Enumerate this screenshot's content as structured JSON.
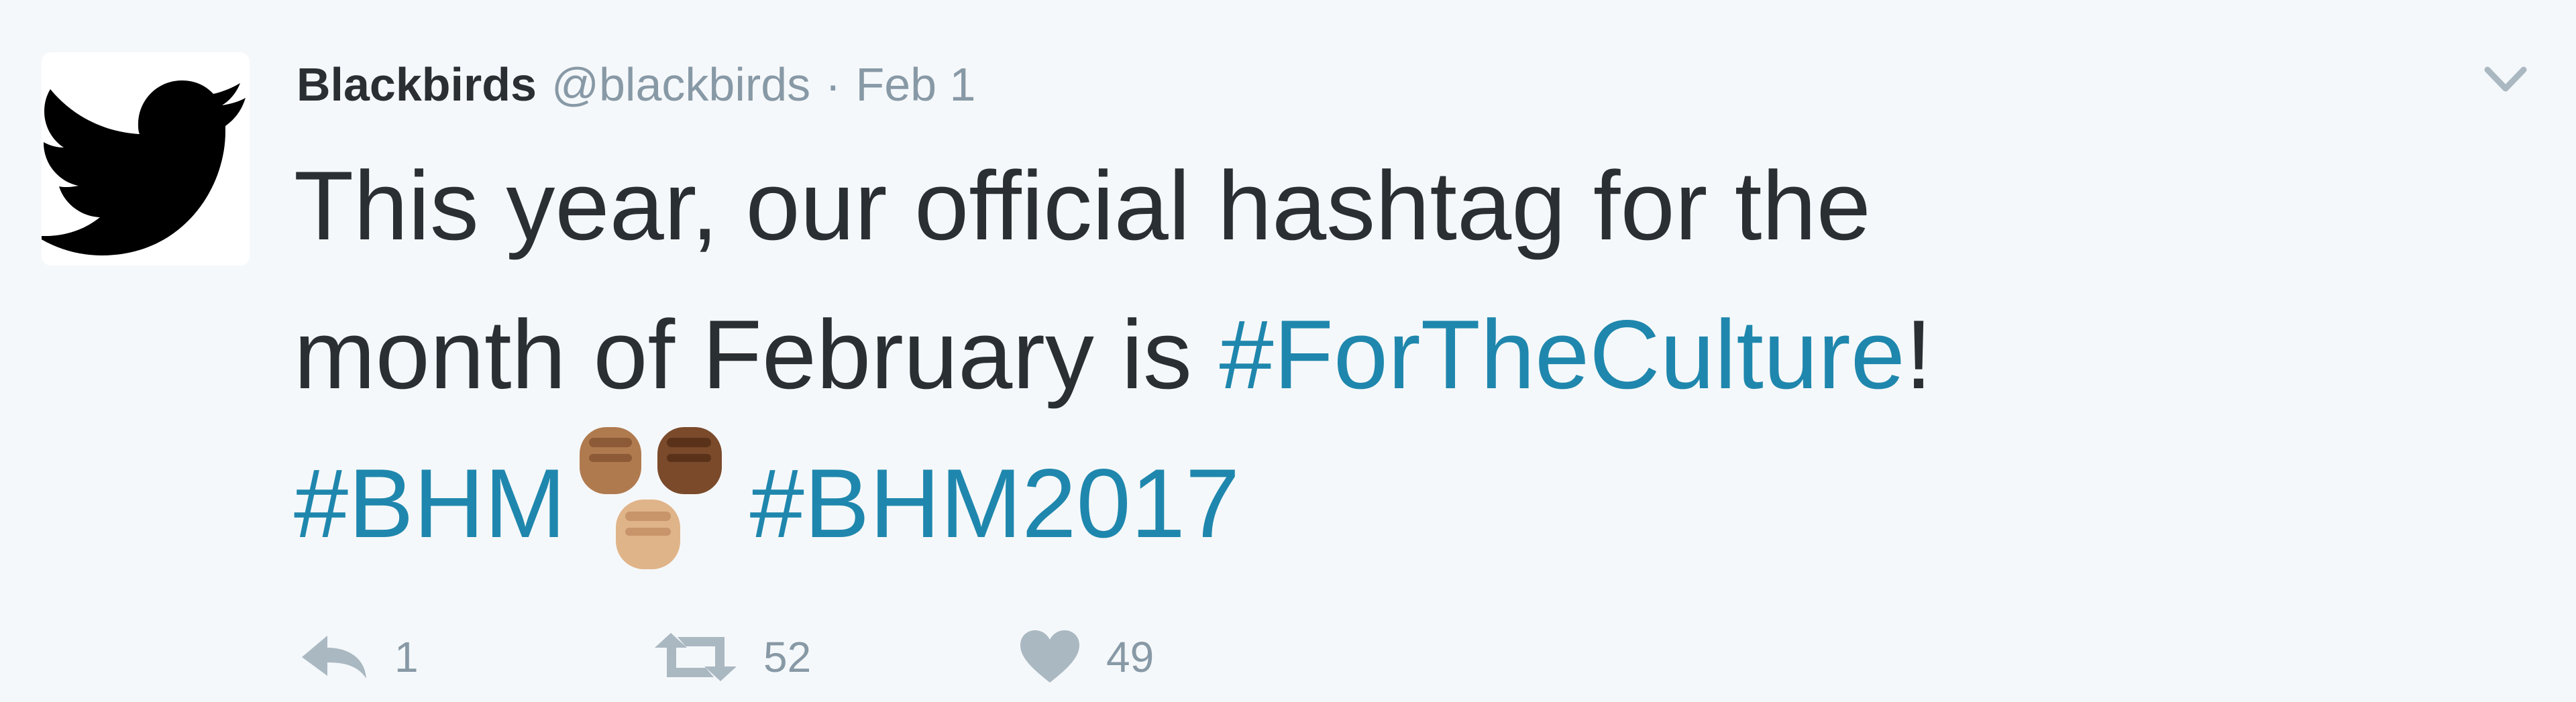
{
  "tweet": {
    "author_name": "Blackbirds",
    "author_handle": "@blackbirds",
    "separator": "·",
    "timestamp": "Feb 1",
    "text_line1": "This year, our official hashtag for the",
    "text_line2_prefix": "month of February is ",
    "hashtag_culture": "#ForTheCulture",
    "text_line2_suffix": "!",
    "hashtag_bhm": "#BHM",
    "hashtag_bhm2017": "#BHM2017"
  },
  "actions": {
    "reply_count": "1",
    "retweet_count": "52",
    "like_count": "49"
  },
  "colors": {
    "background": "#f5f8fa",
    "text": "#292f33",
    "muted": "#8899a6",
    "hashtag": "#1f87ad",
    "icon": "#aab8c2"
  },
  "icons": {
    "avatar": "twitter-bird-icon",
    "caret": "chevron-down-icon",
    "reply": "reply-icon",
    "retweet": "retweet-icon",
    "like": "heart-icon",
    "emoji": "raised-fists-emoji"
  }
}
